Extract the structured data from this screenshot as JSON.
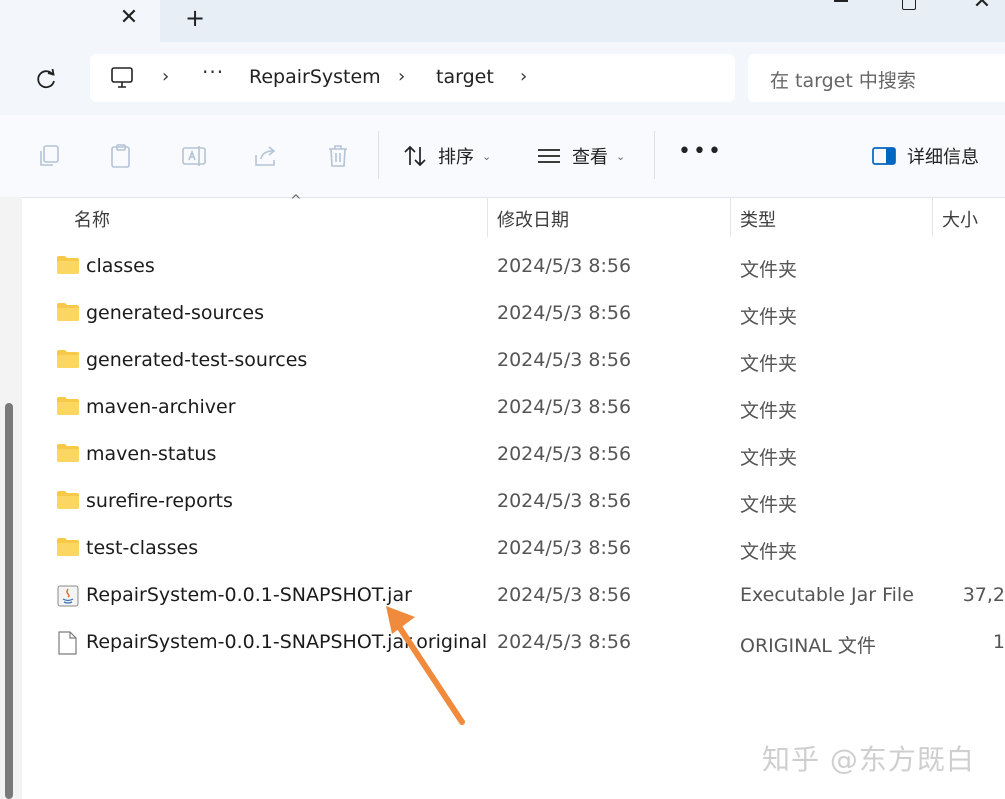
{
  "window": {
    "tab_close": "✕",
    "tab_new": "+"
  },
  "nav": {
    "breadcrumb_more": "···",
    "breadcrumb": [
      "RepairSystem",
      "target"
    ],
    "search_placeholder": "在 target 中搜索"
  },
  "toolbar": {
    "sort_label": "排序",
    "view_label": "查看",
    "more_label": "•••",
    "details_label": "详细信息"
  },
  "columns": {
    "name": "名称",
    "date": "修改日期",
    "type": "类型",
    "size": "大小"
  },
  "files": [
    {
      "name": "classes",
      "date": "2024/5/3 8:56",
      "type": "文件夹",
      "size": "",
      "icon": "folder-icon"
    },
    {
      "name": "generated-sources",
      "date": "2024/5/3 8:56",
      "type": "文件夹",
      "size": "",
      "icon": "folder-icon"
    },
    {
      "name": "generated-test-sources",
      "date": "2024/5/3 8:56",
      "type": "文件夹",
      "size": "",
      "icon": "folder-icon"
    },
    {
      "name": "maven-archiver",
      "date": "2024/5/3 8:56",
      "type": "文件夹",
      "size": "",
      "icon": "folder-icon"
    },
    {
      "name": "maven-status",
      "date": "2024/5/3 8:56",
      "type": "文件夹",
      "size": "",
      "icon": "folder-icon"
    },
    {
      "name": "surefire-reports",
      "date": "2024/5/3 8:56",
      "type": "文件夹",
      "size": "",
      "icon": "folder-icon"
    },
    {
      "name": "test-classes",
      "date": "2024/5/3 8:56",
      "type": "文件夹",
      "size": "",
      "icon": "folder-icon"
    },
    {
      "name": "RepairSystem-0.0.1-SNAPSHOT.jar",
      "date": "2024/5/3 8:56",
      "type": "Executable Jar File",
      "size": "37,2",
      "icon": "java-jar-icon"
    },
    {
      "name": "RepairSystem-0.0.1-SNAPSHOT.jar.original",
      "date": "2024/5/3 8:56",
      "type": "ORIGINAL 文件",
      "size": "1",
      "icon": "file-icon"
    }
  ],
  "watermark": "知乎 @东方既白",
  "colors": {
    "folder": "#f7c948",
    "arrow": "#f08a3c",
    "accent": "#0067c0"
  }
}
